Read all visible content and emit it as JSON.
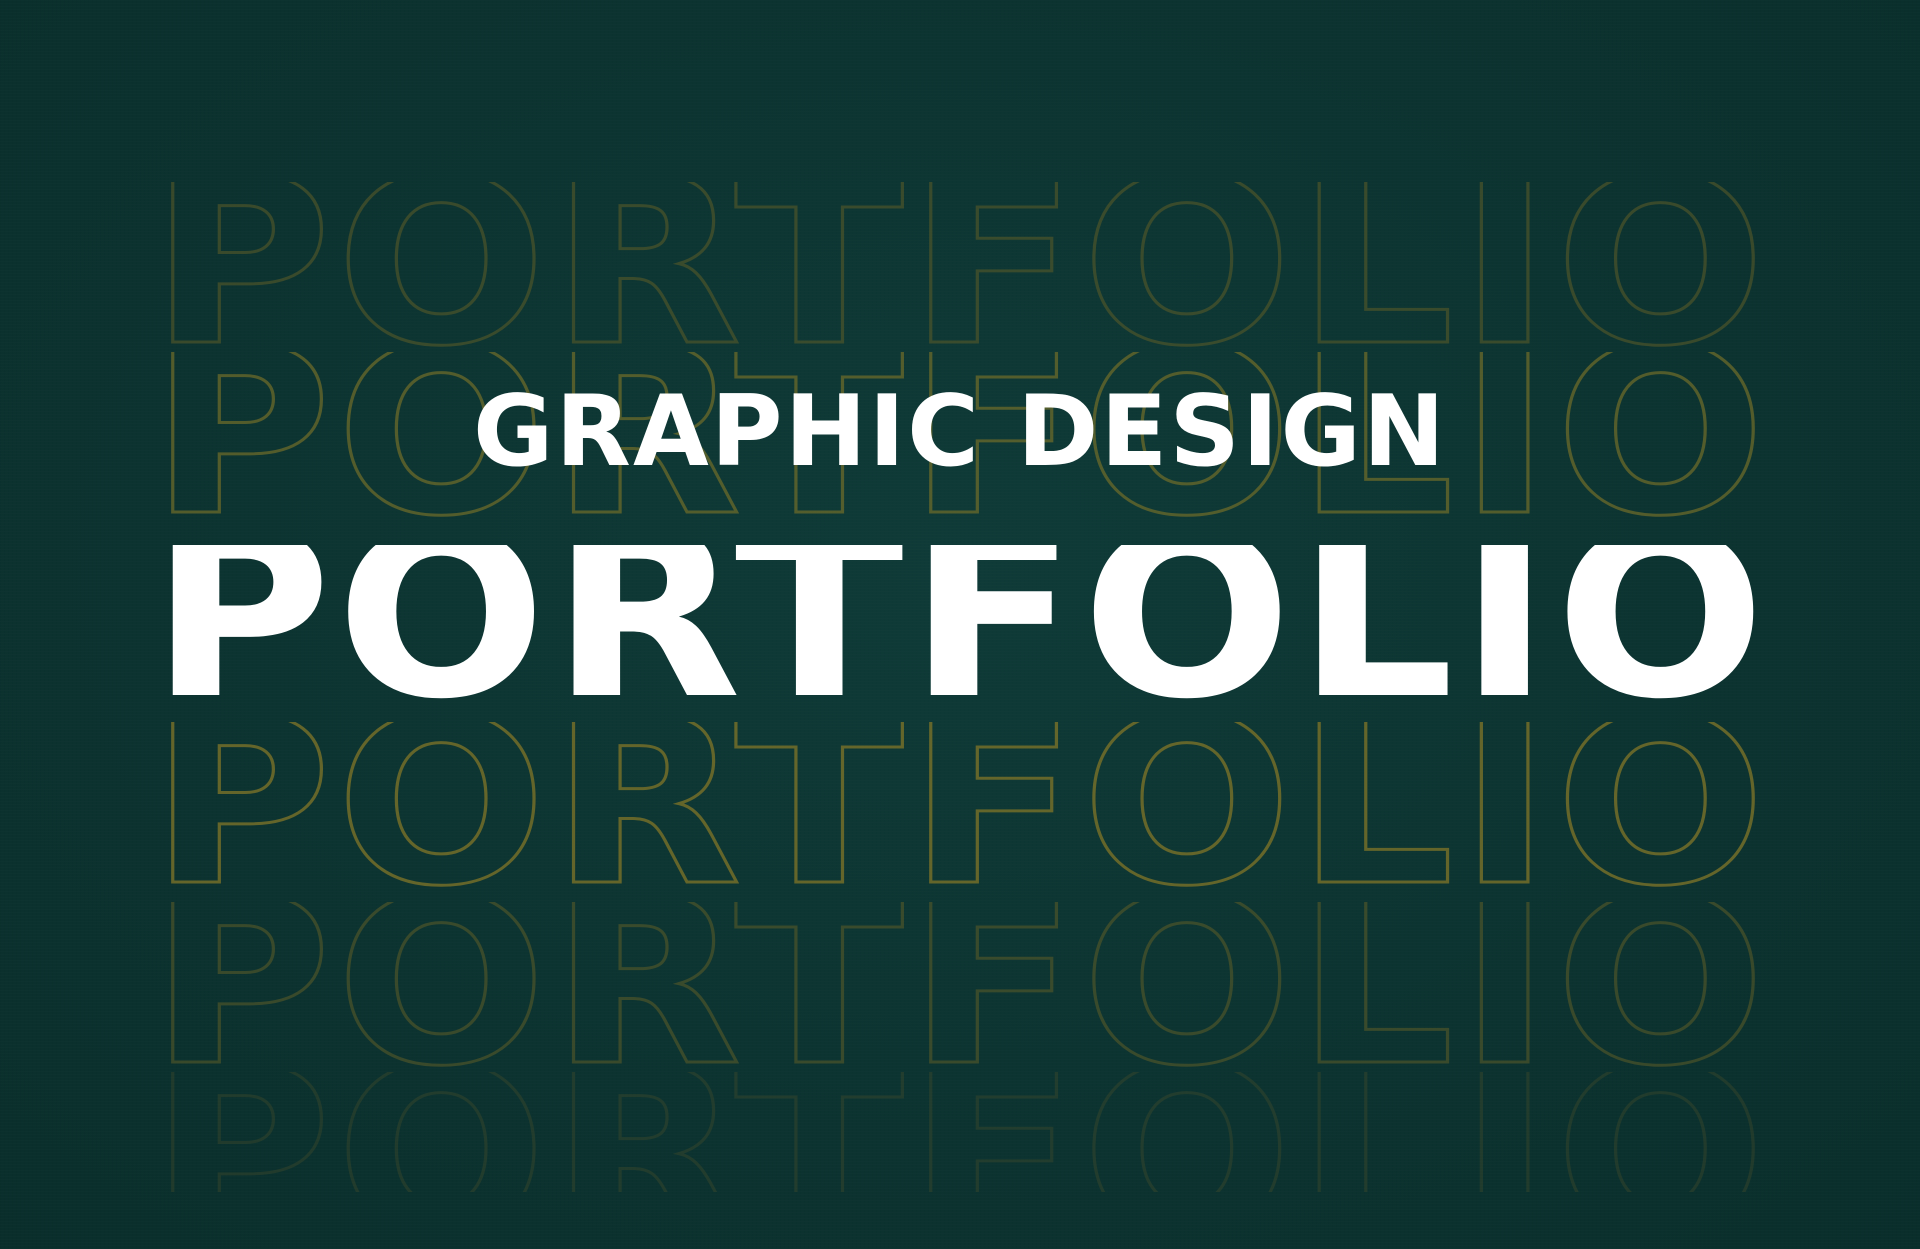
{
  "banner": {
    "subtitle": "GRAPHIC DESIGN",
    "title": "PORTFOLIO",
    "echo_word": "PORTFOLIO"
  },
  "colors": {
    "background": "#0d3532",
    "title": "#ffffff",
    "outline": "#6b6a2a"
  }
}
